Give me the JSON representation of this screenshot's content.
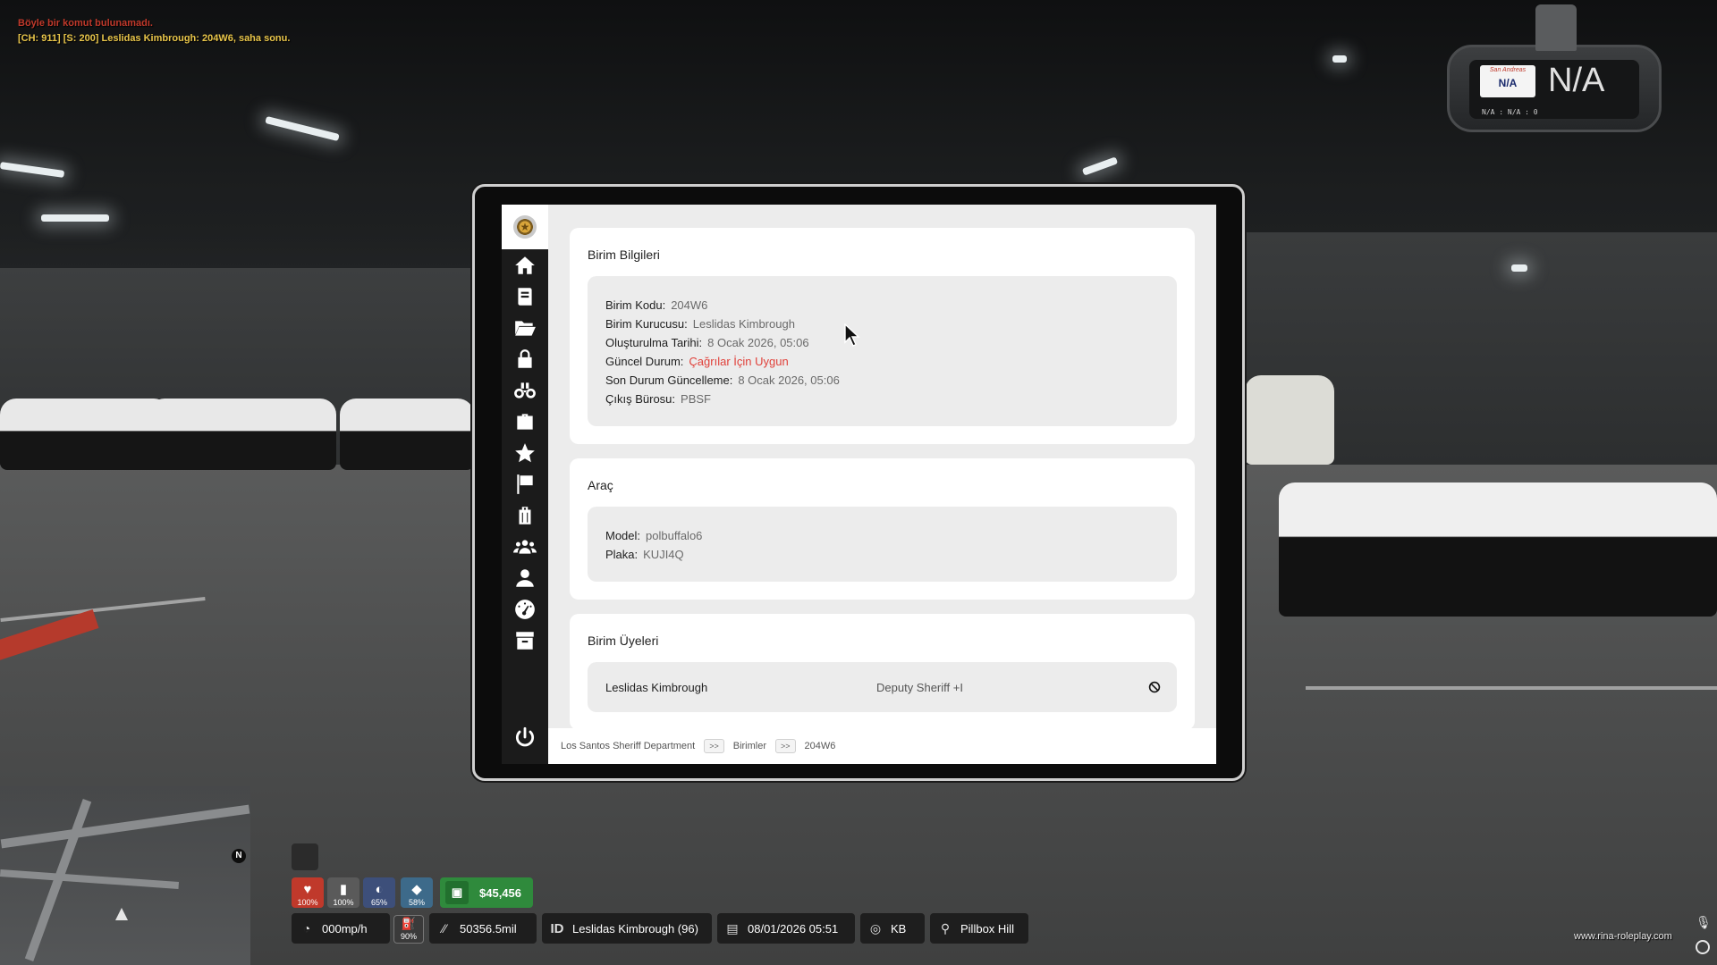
{
  "chat": {
    "error": "Böyle bir komut bulunamadı.",
    "radio": "[CH: 911] [S: 200] Leslidas Kimbrough: 204W6, saha sonu."
  },
  "dashcam": {
    "plate_state": "San Andreas",
    "plate_number": "N/A",
    "big_text": "N/A",
    "small_text": "N/A : N/A : 0"
  },
  "sidebar": {
    "items": [
      {
        "name": "home",
        "icon": "home-icon"
      },
      {
        "name": "book",
        "icon": "book-icon"
      },
      {
        "name": "folder",
        "icon": "folder-open-icon"
      },
      {
        "name": "lock",
        "icon": "lock-icon"
      },
      {
        "name": "binoculars",
        "icon": "binoculars-icon"
      },
      {
        "name": "briefcase",
        "icon": "briefcase-icon"
      },
      {
        "name": "star",
        "icon": "star-icon"
      },
      {
        "name": "flag",
        "icon": "flag-icon"
      },
      {
        "name": "suitcase",
        "icon": "suitcase-icon"
      },
      {
        "name": "users",
        "icon": "users-icon"
      },
      {
        "name": "user",
        "icon": "user-icon"
      },
      {
        "name": "dashboard",
        "icon": "tachometer-icon"
      },
      {
        "name": "archive",
        "icon": "archive-icon"
      }
    ],
    "power_icon": "power-icon"
  },
  "unit_info": {
    "title": "Birim Bilgileri",
    "fields": [
      {
        "label": "Birim Kodu:",
        "value": "204W6"
      },
      {
        "label": "Birim Kurucusu:",
        "value": "Leslidas Kimbrough"
      },
      {
        "label": "Oluşturulma Tarihi:",
        "value": "8 Ocak 2026, 05:06"
      },
      {
        "label": "Güncel Durum:",
        "value": "Çağrılar İçin Uygun"
      },
      {
        "label": "Son Durum Güncelleme:",
        "value": "8 Ocak 2026, 05:06"
      },
      {
        "label": "Çıkış Bürosu:",
        "value": "PBSF"
      }
    ],
    "status_color": "#e0413a"
  },
  "vehicle": {
    "title": "Araç",
    "fields": [
      {
        "label": "Model:",
        "value": "polbuffalo6"
      },
      {
        "label": "Plaka:",
        "value": "KUJI4Q"
      }
    ]
  },
  "members": {
    "title": "Birim Üyeleri",
    "rows": [
      {
        "name": "Leslidas Kimbrough",
        "rank": "Deputy Sheriff +I"
      }
    ]
  },
  "breadcrumb": {
    "items": [
      "Los Santos Sheriff Department",
      "Birimler",
      "204W6"
    ],
    "separator": ">>"
  },
  "hud": {
    "stats": [
      {
        "name": "health",
        "pct": "100%",
        "color": "#c0392b"
      },
      {
        "name": "armor",
        "pct": "100%",
        "color": "#5a5a5a"
      },
      {
        "name": "hunger",
        "pct": "65%",
        "color": "#3d4f7a"
      },
      {
        "name": "thirst",
        "pct": "58%",
        "color": "#3d6a8a"
      }
    ],
    "money": "$45,456",
    "speed": "000mp/h",
    "fuel_pct": "90%",
    "odometer": "50356.5mil",
    "id_label": "ID",
    "player": "Leslidas Kimbrough (96)",
    "datetime": "08/01/2026 05:51",
    "direction": "KB",
    "location": "Pillbox Hill",
    "north": "N"
  },
  "watermark": "www.rina-roleplay.com"
}
